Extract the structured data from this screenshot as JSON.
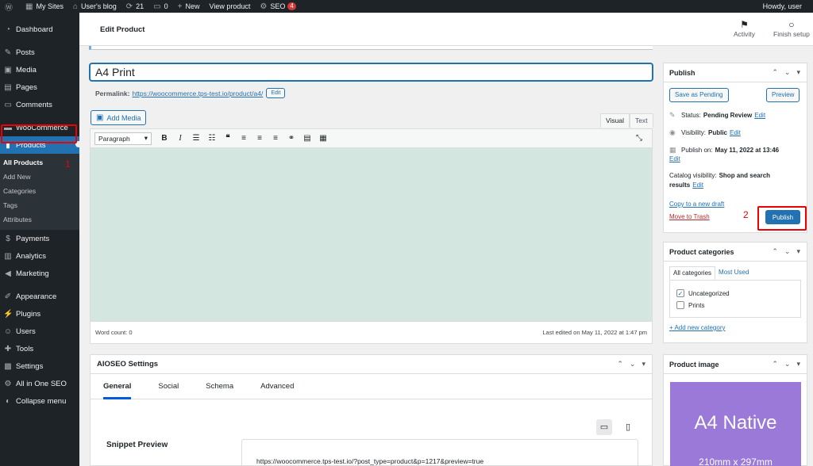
{
  "admin_bar": {
    "my_sites": "My Sites",
    "site_name": "User's blog",
    "updates_count": "21",
    "comments_count": "0",
    "new_label": "New",
    "view_product": "View product",
    "seo_label": "SEO",
    "seo_badge": "4",
    "howdy": "Howdy, user"
  },
  "sidebar": {
    "items": [
      {
        "label": "Dashboard"
      },
      {
        "label": "Posts"
      },
      {
        "label": "Media"
      },
      {
        "label": "Pages"
      },
      {
        "label": "Comments"
      },
      {
        "label": "WooCommerce"
      },
      {
        "label": "Products"
      },
      {
        "label": "Payments"
      },
      {
        "label": "Analytics"
      },
      {
        "label": "Marketing"
      },
      {
        "label": "Appearance"
      },
      {
        "label": "Plugins"
      },
      {
        "label": "Users"
      },
      {
        "label": "Tools"
      },
      {
        "label": "Settings"
      },
      {
        "label": "All in One SEO"
      },
      {
        "label": "Collapse menu"
      }
    ],
    "submenu": [
      "All Products",
      "Add New",
      "Categories",
      "Tags",
      "Attributes"
    ],
    "annotation_1": "1"
  },
  "header": {
    "title": "Edit Product",
    "activity": "Activity",
    "finish_setup": "Finish setup"
  },
  "editor": {
    "title_value": "A4 Print",
    "permalink_label": "Permalink:",
    "permalink_url": "https://woocommerce.tps-test.io/product/a4/",
    "permalink_edit": "Edit",
    "add_media": "Add Media",
    "tab_visual": "Visual",
    "tab_text": "Text",
    "format_select": "Paragraph",
    "word_count": "Word count: 0",
    "last_edited": "Last edited on May 11, 2022 at 1:47 pm"
  },
  "aioseo": {
    "title": "AIOSEO Settings",
    "tabs": [
      "General",
      "Social",
      "Schema",
      "Advanced"
    ],
    "snippet_label": "Snippet Preview",
    "snippet_url": "https://woocommerce.tps-test.io/?post_type=product&p=1217&preview=true"
  },
  "publish": {
    "title": "Publish",
    "save_pending": "Save as Pending",
    "preview": "Preview",
    "status_label": "Status:",
    "status_value": "Pending Review",
    "visibility_label": "Visibility:",
    "visibility_value": "Public",
    "publish_on_label": "Publish on:",
    "publish_on_value": "May 11, 2022 at 13:46",
    "edit": "Edit",
    "catalog_label": "Catalog visibility:",
    "catalog_value_1": "Shop and search",
    "catalog_value_2": "results",
    "copy_draft": "Copy to a new draft",
    "move_trash": "Move to Trash",
    "publish_button": "Publish",
    "annotation_2": "2"
  },
  "categories": {
    "title": "Product categories",
    "tab_all": "All categories",
    "tab_most_used": "Most Used",
    "items": [
      {
        "label": "Uncategorized",
        "checked": true
      },
      {
        "label": "Prints",
        "checked": false
      }
    ],
    "add_new": "+ Add new category"
  },
  "product_image": {
    "title": "Product image",
    "image_title": "A4 Native",
    "image_sub": "210mm x 297mm"
  },
  "colors": {
    "admin_dark": "#1d2327",
    "accent_blue": "#2271b1",
    "annotation_red": "#e00000",
    "editor_bg": "#d3e6df",
    "image_purple": "#9a79d9"
  }
}
